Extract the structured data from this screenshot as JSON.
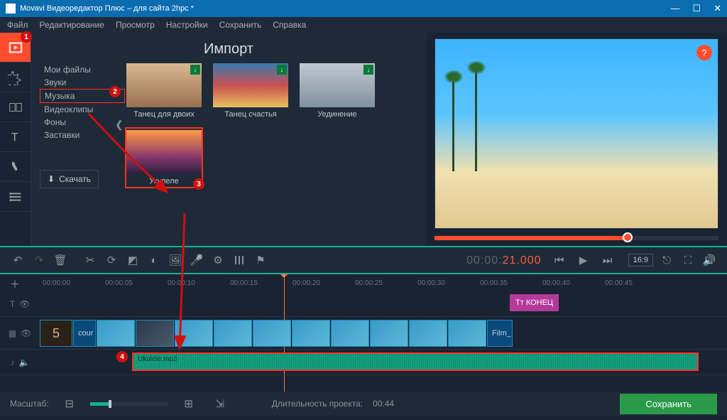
{
  "titlebar": {
    "title": "Movavi Видеоредактор Плюс – для сайта 2hpc *"
  },
  "menubar": [
    "Файл",
    "Редактирование",
    "Просмотр",
    "Настройки",
    "Сохранить",
    "Справка"
  ],
  "import": {
    "title": "Импорт",
    "sidebar": [
      "Мои файлы",
      "Звуки",
      "Музыка",
      "Видеоклипы",
      "Фоны",
      "Заставки"
    ],
    "selected_index": 2,
    "download_label": "Скачать",
    "thumbs": [
      {
        "label": "Танец для двоих",
        "hl": false
      },
      {
        "label": "Танец счастья",
        "hl": false
      },
      {
        "label": "Уединение",
        "hl": false
      },
      {
        "label": "Укулеле",
        "hl": true
      }
    ]
  },
  "callouts": {
    "c1": "1",
    "c2": "2",
    "c3": "3",
    "c4": "4"
  },
  "help": "?",
  "toolbar": {
    "timecode_gray": "00:00:",
    "timecode_red": "21.000",
    "aspect": "16:9"
  },
  "ruler": {
    "ticks": [
      "00:00:00",
      "00:00:05",
      "00:00:10",
      "00:00:15",
      "00:00:20",
      "00:00:25",
      "00:00:30",
      "00:00:35",
      "00:00:40",
      "00:00:45"
    ]
  },
  "tracks": {
    "text_clip": "Тт КОНЕЦ",
    "video_count": "5",
    "video_start_label": "cour",
    "video_end_label": "Film_",
    "audio_clip": "Ukulele.mp3"
  },
  "statusbar": {
    "scale_label": "Масштаб:",
    "duration_label": "Длительность проекта:",
    "duration_value": "00:44",
    "save_label": "Сохранить"
  }
}
